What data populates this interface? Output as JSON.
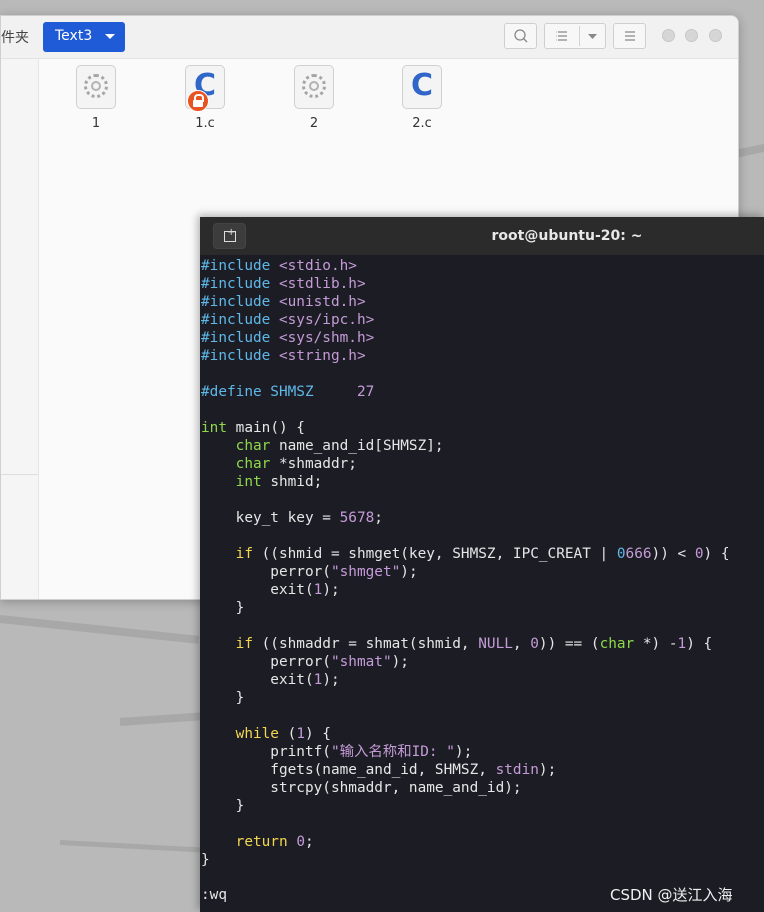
{
  "file_manager": {
    "breadcrumb_prev": "件夹",
    "breadcrumb_current": "Text3",
    "files": [
      {
        "label": "1",
        "icon": "executable-icon",
        "locked": false
      },
      {
        "label": "1.c",
        "icon": "c-source-icon",
        "locked": true
      },
      {
        "label": "2",
        "icon": "executable-icon",
        "locked": false
      },
      {
        "label": "2.c",
        "icon": "c-source-icon",
        "locked": false
      }
    ]
  },
  "terminal": {
    "title": "root@ubuntu-20: ~",
    "command_line": ":wq"
  },
  "watermark": "CSDN @送江入海",
  "colors": {
    "accent": "#1f5bd6",
    "terminal_bg": "#1c1c25",
    "preprocessor": "#5fb8e8",
    "string": "#c49bd6",
    "type": "#8ed94a",
    "control": "#f2d650"
  }
}
